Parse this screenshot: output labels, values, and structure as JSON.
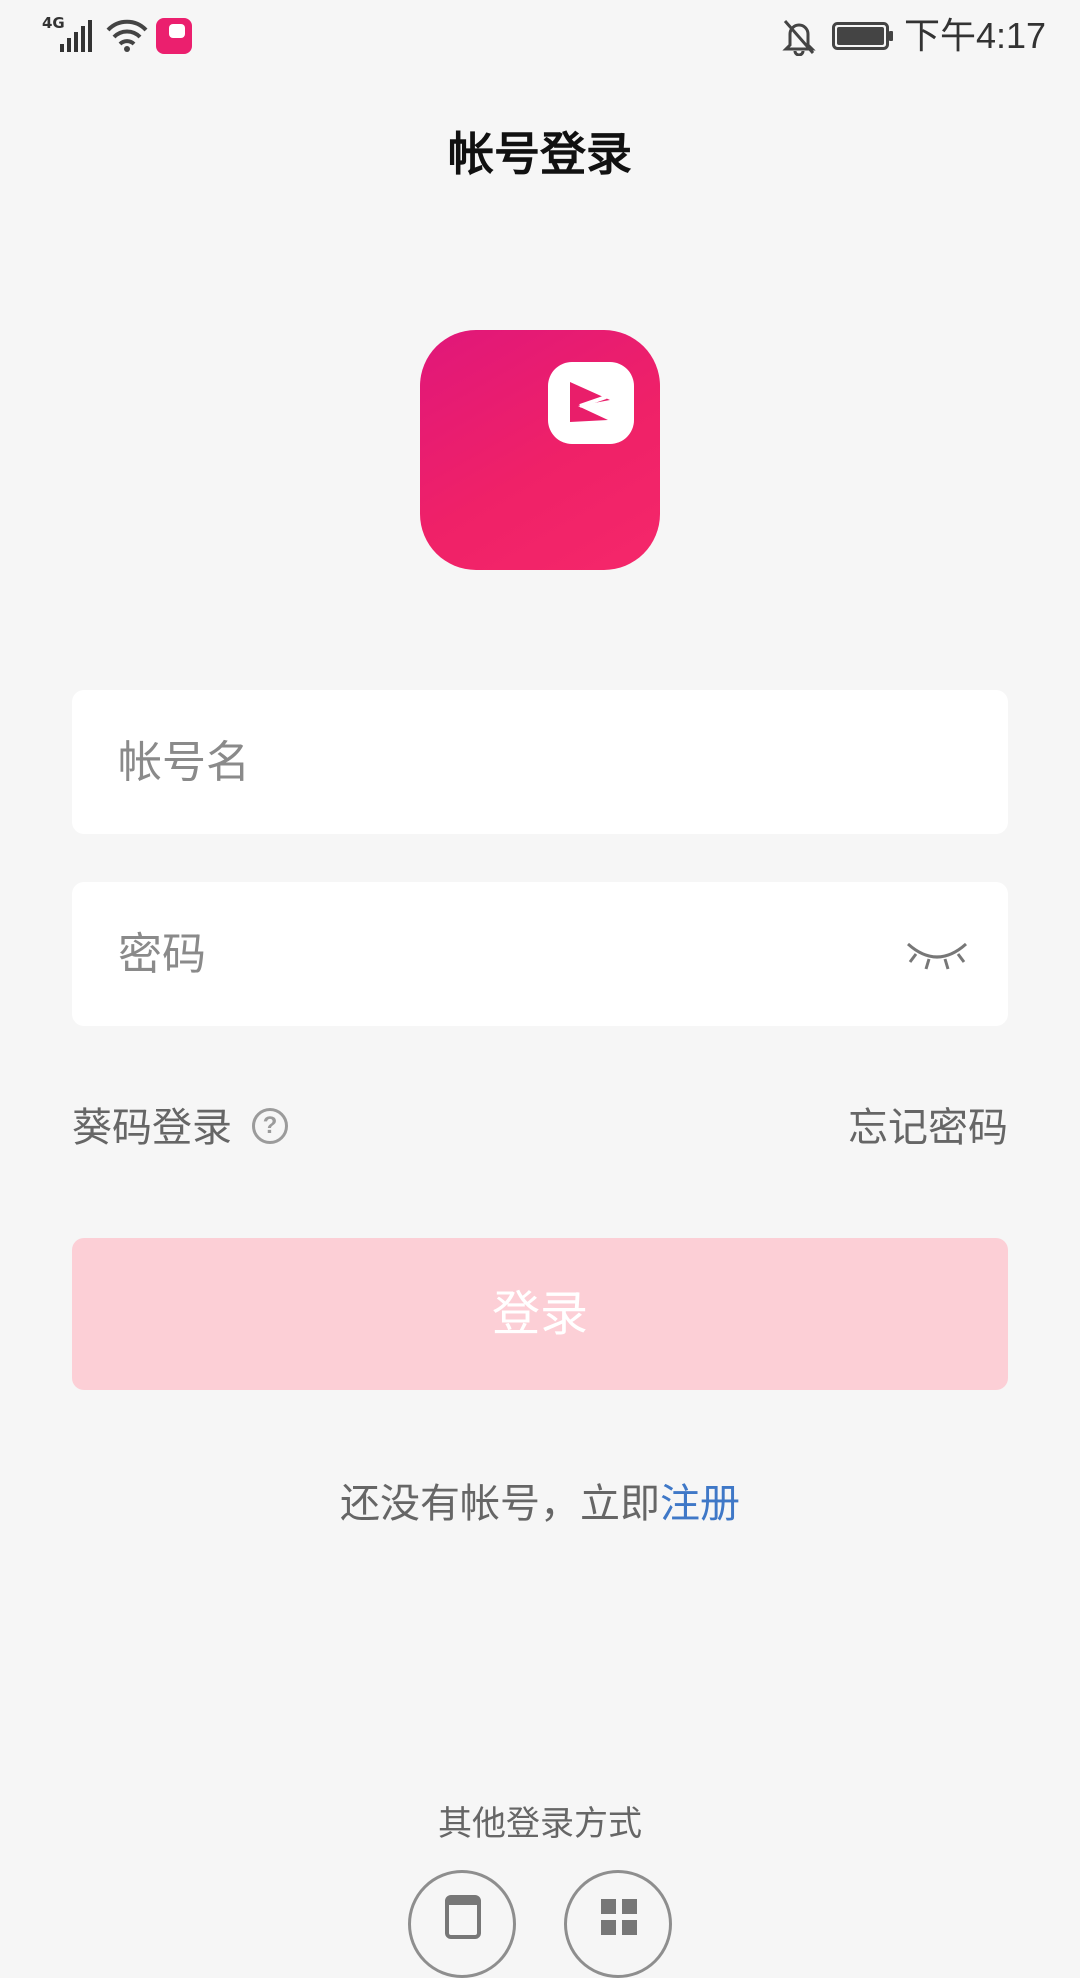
{
  "status_bar": {
    "network": "4G",
    "time": "下午4:17",
    "icons": [
      "signal-icon",
      "wifi-icon",
      "app-notification-icon",
      "mute-bell-icon",
      "battery-icon"
    ]
  },
  "header": {
    "title": "帐号登录"
  },
  "logo": {
    "icon": "app-logo-icon",
    "brand_color": "#eb1f6e"
  },
  "form": {
    "account_placeholder": "帐号名",
    "account_value": "",
    "password_placeholder": "密码",
    "password_value": "",
    "password_toggle_icon": "eye-closed-icon"
  },
  "options": {
    "code_login_label": "葵码登录",
    "help_icon": "question-circle-icon",
    "forgot_password_label": "忘记密码"
  },
  "login_button": {
    "label": "登录",
    "color": "#fccfd6"
  },
  "register": {
    "prompt": "还没有帐号，立即",
    "link_label": "注册",
    "link_color": "#3f78c7"
  },
  "other_login": {
    "label": "其他登录方式",
    "methods": [
      "phone-icon",
      "qr-code-icon"
    ]
  }
}
